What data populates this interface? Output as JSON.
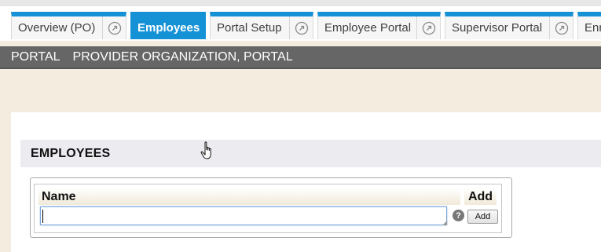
{
  "tabs": [
    {
      "label": "Overview (PO)",
      "external": true
    },
    {
      "label": "Employees",
      "active": true
    },
    {
      "label": "Portal Setup",
      "external": true
    },
    {
      "label": "Employee Portal",
      "external": true
    },
    {
      "label": "Supervisor Portal",
      "external": true
    },
    {
      "label": "Enr"
    }
  ],
  "org_bar": {
    "role": "PORTAL",
    "organization": "PROVIDER ORGANIZATION, PORTAL"
  },
  "section": {
    "title": "EMPLOYEES"
  },
  "grid": {
    "columns": {
      "name": "Name",
      "add": "Add"
    },
    "name_input_value": "",
    "help_icon_glyph": "?",
    "add_button_label": "Add"
  },
  "colors": {
    "tab_accent": "#1592d6",
    "org_bar_bg": "#666666",
    "page_bg": "#f4ecdf"
  },
  "icons": [
    "external-link-icon",
    "help-icon",
    "hand-pointer-cursor"
  ]
}
